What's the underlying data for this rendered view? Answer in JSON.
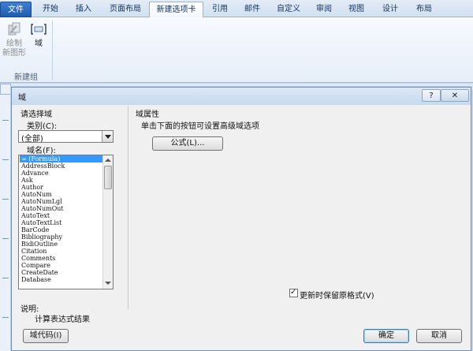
{
  "ribbon_tabs": [
    {
      "label": "文件",
      "type": "file"
    },
    {
      "label": "开始",
      "type": "normal"
    },
    {
      "label": "插入",
      "type": "normal"
    },
    {
      "label": "页面布局",
      "type": "normal"
    },
    {
      "label": "新建选项卡",
      "type": "active"
    },
    {
      "label": "引用",
      "type": "normal"
    },
    {
      "label": "邮件",
      "type": "normal"
    },
    {
      "label": "自定义",
      "type": "normal"
    },
    {
      "label": "审阅",
      "type": "normal"
    },
    {
      "label": "视图",
      "type": "normal"
    },
    {
      "label": "设计",
      "type": "normal"
    },
    {
      "label": "布局",
      "type": "normal"
    }
  ],
  "ribbon": {
    "draw_shape_label": "绘制\n新图形",
    "field_label": "域",
    "group_label": "新建组"
  },
  "dialog": {
    "title": "域",
    "help_glyph": "?",
    "close_glyph": "✕",
    "choose_field_title": "请选择域",
    "category_label": "类别(C):",
    "category_value": "(全部)",
    "field_names_label": "域名(F):",
    "field_names": [
      "= (Formula)",
      "AddressBlock",
      "Advance",
      "Ask",
      "Author",
      "AutoNum",
      "AutoNumLgl",
      "AutoNumOut",
      "AutoText",
      "AutoTextList",
      "BarCode",
      "Bibliography",
      "BidiOutline",
      "Citation",
      "Comments",
      "Compare",
      "CreateDate",
      "Database"
    ],
    "selected_field": "= (Formula)",
    "field_properties_title": "域属性",
    "field_properties_hint": "单击下面的按钮可设置高级域选项",
    "formula_button": "公式(L)...",
    "preserve_format_label": "更新时保留原格式(V)",
    "preserve_format_checked": true,
    "description_label": "说明:",
    "description_text": "计算表达式结果",
    "field_codes_button": "域代码(I)",
    "ok_button": "确定",
    "cancel_button": "取消"
  }
}
